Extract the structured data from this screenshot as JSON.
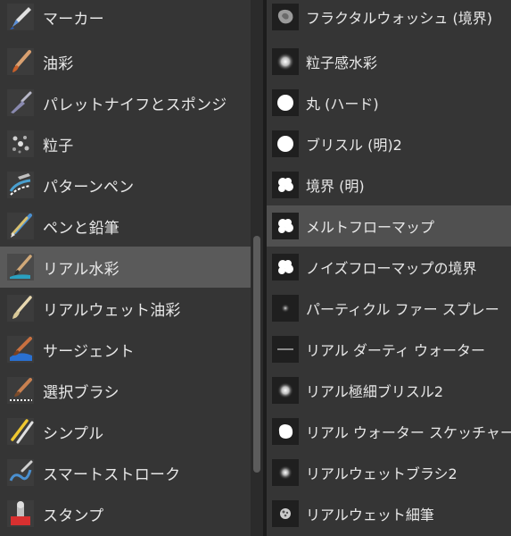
{
  "categories": [
    {
      "label": "マーカー",
      "icon": "marker-icon"
    },
    {
      "label": "油彩",
      "icon": "oil-brush-icon"
    },
    {
      "label": "パレットナイフとスポンジ",
      "icon": "palette-knife-icon"
    },
    {
      "label": "粒子",
      "icon": "particle-icon"
    },
    {
      "label": "パターンペン",
      "icon": "pattern-pen-icon"
    },
    {
      "label": "ペンと鉛筆",
      "icon": "pen-pencil-icon"
    },
    {
      "label": "リアル水彩",
      "icon": "real-watercolor-icon"
    },
    {
      "label": "リアルウェット油彩",
      "icon": "real-wet-oil-icon"
    },
    {
      "label": "サージェント",
      "icon": "sargent-icon"
    },
    {
      "label": "選択ブラシ",
      "icon": "selection-brush-icon"
    },
    {
      "label": "シンプル",
      "icon": "simple-icon"
    },
    {
      "label": "スマートストローク",
      "icon": "smart-stroke-icon"
    },
    {
      "label": "スタンプ",
      "icon": "stamp-icon"
    }
  ],
  "selected_category": "リアル水彩",
  "brushes": [
    {
      "label": "フラクタルウォッシュ (境界)",
      "icon": "fractal-wash-thumbnail-icon"
    },
    {
      "label": "粒子感水彩",
      "icon": "soft-dot-thumbnail-icon"
    },
    {
      "label": "丸 (ハード)",
      "icon": "hard-round-thumbnail-icon"
    },
    {
      "label": "ブリスル (明)2",
      "icon": "hard-round-thumbnail-icon"
    },
    {
      "label": "境界 (明)",
      "icon": "cloud-blob-thumbnail-icon"
    },
    {
      "label": "メルトフローマップ",
      "icon": "cloud-blob-thumbnail-icon"
    },
    {
      "label": "ノイズフローマップの境界",
      "icon": "cloud-blob-thumbnail-icon"
    },
    {
      "label": "パーティクル ファー スプレー",
      "icon": "small-dot-thumbnail-icon"
    },
    {
      "label": "リアル ダーティ ウォーター",
      "icon": "streak-thumbnail-icon"
    },
    {
      "label": "リアル極細ブリスル2",
      "icon": "soft-dot-thumbnail-icon"
    },
    {
      "label": "リアル ウォーター スケッチャー",
      "icon": "rough-blob-thumbnail-icon"
    },
    {
      "label": "リアルウェットブラシ2",
      "icon": "soft-dot-thumbnail-icon"
    },
    {
      "label": "リアルウェット細筆",
      "icon": "sparkle-dot-thumbnail-icon"
    }
  ],
  "selected_brush": "メルトフローマップ",
  "colors": {
    "panel_bg": "#353535",
    "selected_category_bg": "#5a5a5a",
    "selected_brush_bg": "#505050",
    "text": "#e8e8e8"
  }
}
